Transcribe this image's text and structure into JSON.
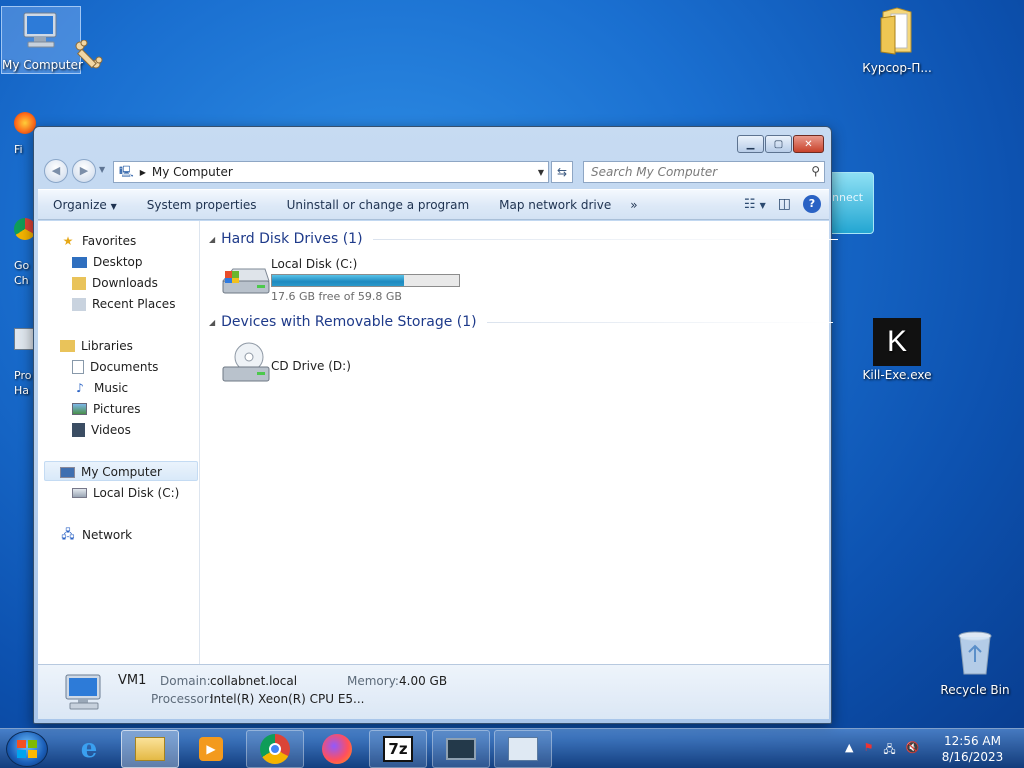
{
  "desktop": {
    "icons": {
      "my_computer": "My Computer",
      "folder": "Курсор-П...",
      "kill_exe": "Kill-Exe.exe",
      "recycle_bin": "Recycle Bin"
    },
    "partial_labels": {
      "firefox": "Fi",
      "chrome": "Go\nCh",
      "program": "Pro\nHa",
      "connect": "nnect"
    }
  },
  "window": {
    "address": "My Computer",
    "search_placeholder": "Search My Computer",
    "toolbar": {
      "organize": "Organize",
      "system_properties": "System properties",
      "uninstall": "Uninstall or change a program",
      "map_drive": "Map network drive",
      "more": "»"
    },
    "nav": {
      "favorites": "Favorites",
      "desktop": "Desktop",
      "downloads": "Downloads",
      "recent_places": "Recent Places",
      "libraries": "Libraries",
      "documents": "Documents",
      "music": "Music",
      "pictures": "Pictures",
      "videos": "Videos",
      "my_computer": "My Computer",
      "local_disk": "Local Disk (C:)",
      "network": "Network"
    },
    "groups": {
      "hdd": "Hard Disk Drives (1)",
      "removable": "Devices with Removable Storage (1)"
    },
    "drives": {
      "c": {
        "name": "Local Disk (C:)",
        "free": "17.6 GB free of 59.8 GB",
        "used_fraction": 0.706
      },
      "d": {
        "name": "CD Drive (D:)"
      }
    },
    "details": {
      "computer_name": "VM1",
      "domain_label": "Domain:",
      "domain": "collabnet.local",
      "memory_label": "Memory:",
      "memory": "4.00 GB",
      "processor_label": "Processor:",
      "processor": "Intel(R) Xeon(R) CPU E5..."
    }
  },
  "taskbar": {
    "clock_time": "12:56 AM",
    "clock_date": "8/16/2023",
    "apps": [
      "Internet Explorer",
      "Windows Explorer",
      "Media Player",
      "Google Chrome",
      "Firefox",
      "7-Zip",
      "Process Monitor",
      "Network Tool"
    ]
  },
  "colors": {
    "accent": "#1e3a8a",
    "progress": "#2a9acb",
    "desktop": "#1a6fd0"
  }
}
